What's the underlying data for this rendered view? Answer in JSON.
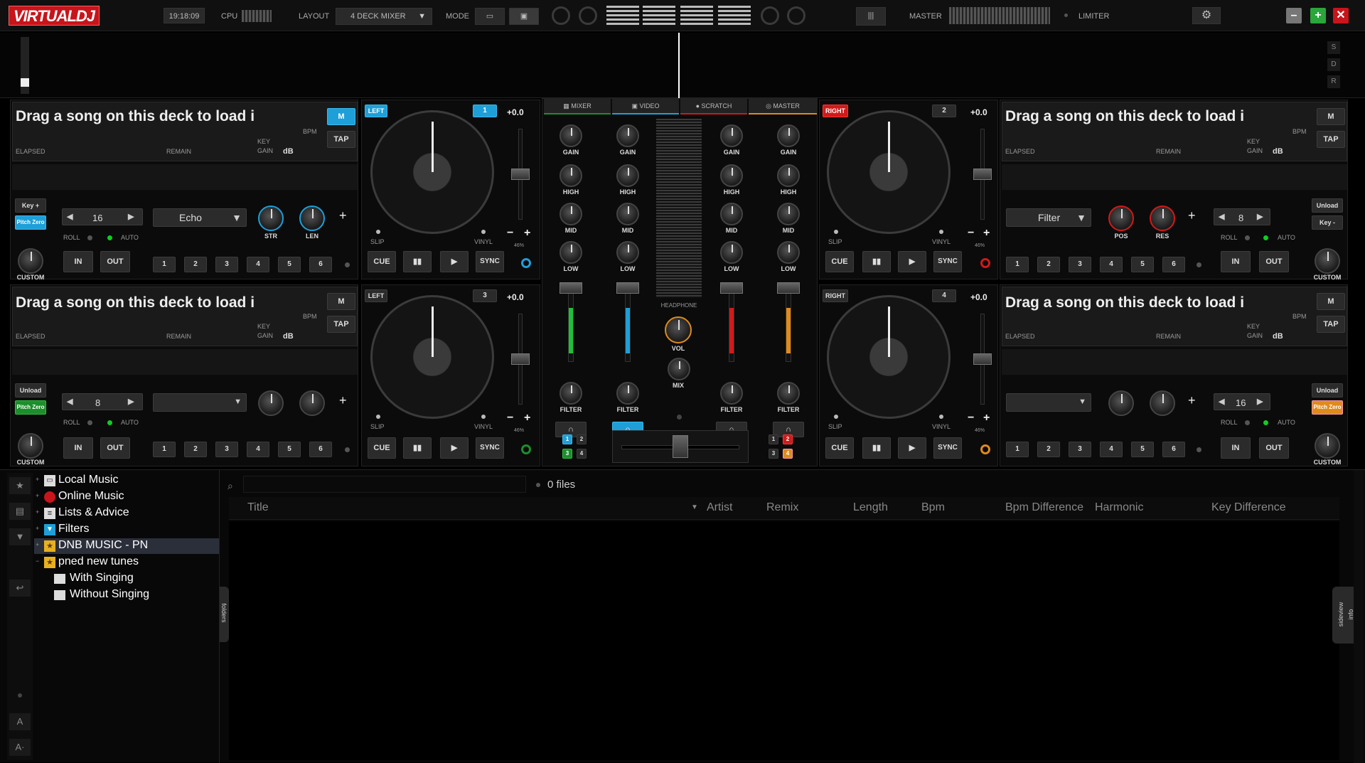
{
  "top": {
    "logo": "VIRTUALDJ",
    "clock": "19:18:09",
    "cpu_label": "CPU",
    "layout_label": "LAYOUT",
    "layout_value": "4 DECK MIXER",
    "mode_label": "MODE",
    "master_label": "MASTER",
    "limiter_label": "LIMITER"
  },
  "side_letters": [
    "S",
    "D",
    "R"
  ],
  "deck": {
    "title": "Drag a song on this deck to load it",
    "elapsed": "ELAPSED",
    "remain": "REMAIN",
    "bpm": "BPM",
    "key": "KEY",
    "gain": "GAIN",
    "db": "dB",
    "m": "M",
    "tap": "TAP",
    "slip": "SLIP",
    "vinyl": "VINYL",
    "pitch": "+0.0",
    "pct": "46%",
    "cue": "CUE",
    "sync": "SYNC",
    "in": "IN",
    "out": "OUT",
    "roll": "ROLL",
    "auto": "AUTO",
    "custom": "CUSTOM",
    "key_plus": "Key +",
    "key_minus": "Key -",
    "unload": "Unload",
    "pitch_zero": "Pitch Zero",
    "pads": [
      "1",
      "2",
      "3",
      "4",
      "5",
      "6"
    ]
  },
  "decks": [
    {
      "num": "1",
      "side": "LEFT",
      "loop": "16",
      "fx": "Echo",
      "k1": "STR",
      "k2": "LEN"
    },
    {
      "num": "2",
      "side": "RIGHT",
      "loop": "8",
      "fx": "Filter",
      "k1": "POS",
      "k2": "RES"
    },
    {
      "num": "3",
      "side": "LEFT",
      "loop": "8",
      "fx": "",
      "k1": "",
      "k2": ""
    },
    {
      "num": "4",
      "side": "RIGHT",
      "loop": "16",
      "fx": "",
      "k1": "",
      "k2": ""
    }
  ],
  "mixer": {
    "tabs": [
      "MIXER",
      "VIDEO",
      "SCRATCH",
      "MASTER"
    ],
    "gain": "GAIN",
    "high": "HIGH",
    "mid": "MID",
    "low": "LOW",
    "filter": "FILTER",
    "headphone": "HEADPHONE",
    "vol": "VOL",
    "mix": "MIX",
    "nums": [
      "1",
      "2",
      "3",
      "4"
    ]
  },
  "colors": {
    "blue": "#1e9fd8",
    "red": "#d11a1a",
    "green": "#1a8f2a",
    "orange": "#e08a1a"
  },
  "browser": {
    "tree": [
      {
        "label": "Local Music",
        "icon": "computer-icon"
      },
      {
        "label": "Online Music",
        "icon": "online-icon"
      },
      {
        "label": "Lists & Advice",
        "icon": "list-icon"
      },
      {
        "label": "Filters",
        "icon": "filter-icon"
      },
      {
        "label": "DNB MUSIC - PN",
        "icon": "star-folder-icon"
      },
      {
        "label": "pned new tunes",
        "icon": "star-folder-icon"
      },
      {
        "label": "With Singing",
        "icon": "folder-icon"
      },
      {
        "label": "Without Singing",
        "icon": "folder-icon"
      }
    ],
    "search_placeholder": "",
    "files": "0 files",
    "columns": [
      "Title",
      "Artist",
      "Remix",
      "Length",
      "Bpm",
      "Bpm Difference",
      "Harmonic",
      "Key Difference"
    ],
    "folders_tab": "folders",
    "sideview_tab": "sideview",
    "info_tab": "info"
  }
}
